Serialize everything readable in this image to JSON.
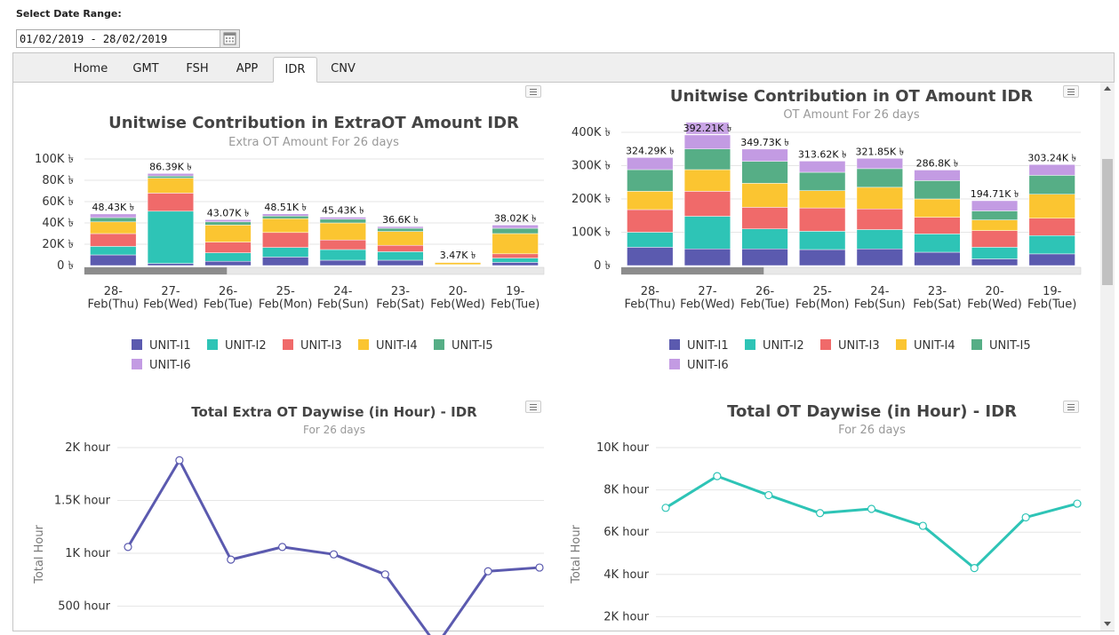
{
  "date_range": {
    "label": "Select Date Range:",
    "value": "01/02/2019 - 28/02/2019"
  },
  "tabs": [
    "Home",
    "GMT",
    "FSH",
    "APP",
    "IDR",
    "CNV"
  ],
  "active_tab": "IDR",
  "icons": {
    "calendar": "calendar-icon",
    "menu": "menu-icon"
  },
  "colors": {
    "unit_i1": "#5b5aaf",
    "unit_i2": "#2ec4b6",
    "unit_i3": "#f06a6a",
    "unit_i4": "#fbc531",
    "unit_i5": "#56ae86",
    "unit_i6": "#c39be3",
    "line_left": "#5b5aaf",
    "line_right": "#2ec4b6"
  },
  "chart_data": [
    {
      "type": "bar",
      "stacked": true,
      "title": "Unitwise Contribution in ExtraOT Amount IDR",
      "subtitle": "Extra OT Amount For 26 days",
      "categories": [
        "28-Feb(Thu)",
        "27-Feb(Wed)",
        "26-Feb(Tue)",
        "25-Feb(Mon)",
        "24-Feb(Sun)",
        "23-Feb(Sat)",
        "20-Feb(Wed)",
        "19-Feb(Tue)"
      ],
      "yticks": [
        "0 ৳",
        "20K ৳",
        "40K ৳",
        "60K ৳",
        "80K ৳",
        "100K ৳"
      ],
      "ylim": [
        0,
        100000
      ],
      "totals_labels": [
        "48.43K ৳",
        "86.39K ৳",
        "43.07K ৳",
        "48.51K ৳",
        "45.43K ৳",
        "36.6K ৳",
        "3.47K ৳",
        "38.02K ৳"
      ],
      "series": [
        {
          "name": "UNIT-I1",
          "values": [
            10000,
            2000,
            4000,
            8000,
            5000,
            5000,
            300,
            3000
          ]
        },
        {
          "name": "UNIT-I2",
          "values": [
            8000,
            49000,
            8000,
            9000,
            10000,
            8000,
            300,
            4000
          ]
        },
        {
          "name": "UNIT-I3",
          "values": [
            12000,
            17000,
            10000,
            14000,
            9000,
            6000,
            300,
            4000
          ]
        },
        {
          "name": "UNIT-I4",
          "values": [
            11000,
            14000,
            16000,
            13000,
            16000,
            13000,
            2000,
            19000
          ]
        },
        {
          "name": "UNIT-I5",
          "values": [
            4000,
            2000,
            3000,
            2500,
            3500,
            3000,
            300,
            5000
          ]
        },
        {
          "name": "UNIT-I6",
          "values": [
            3430,
            2390,
            2070,
            2010,
            1930,
            1600,
            270,
            3020
          ]
        }
      ]
    },
    {
      "type": "bar",
      "stacked": true,
      "title": "Unitwise Contribution in OT Amount IDR",
      "subtitle": "OT Amount For 26 days",
      "categories": [
        "28-Feb(Thu)",
        "27-Feb(Wed)",
        "26-Feb(Tue)",
        "25-Feb(Mon)",
        "24-Feb(Sun)",
        "23-Feb(Sat)",
        "20-Feb(Wed)",
        "19-Feb(Tue)"
      ],
      "yticks": [
        "0 ৳",
        "100K ৳",
        "200K ৳",
        "300K ৳",
        "400K ৳"
      ],
      "ylim": [
        0,
        400000
      ],
      "totals_labels": [
        "324.29K ৳",
        "392.21K ৳",
        "349.73K ৳",
        "313.62K ৳",
        "321.85K ৳",
        "286.8K ৳",
        "194.71K ৳",
        "303.24K ৳"
      ],
      "series": [
        {
          "name": "UNIT-I1",
          "values": [
            55000,
            50000,
            50000,
            48000,
            50000,
            40000,
            20000,
            35000
          ]
        },
        {
          "name": "UNIT-I2",
          "values": [
            45000,
            98000,
            60000,
            55000,
            58000,
            55000,
            35000,
            55000
          ]
        },
        {
          "name": "UNIT-I3",
          "values": [
            68000,
            75000,
            65000,
            70000,
            62000,
            50000,
            50000,
            52000
          ]
        },
        {
          "name": "UNIT-I4",
          "values": [
            55000,
            65000,
            72000,
            52000,
            65000,
            55000,
            32000,
            72000
          ]
        },
        {
          "name": "UNIT-I5",
          "values": [
            65000,
            62000,
            66000,
            55000,
            56000,
            55000,
            27000,
            57000
          ]
        },
        {
          "name": "UNIT-I6",
          "values": [
            36290,
            42210,
            36730,
            33620,
            30850,
            31800,
            30710,
            32240
          ]
        }
      ]
    },
    {
      "type": "line",
      "title": "Total Extra OT Daywise (in Hour) - IDR",
      "subtitle": "For 26 days",
      "ylabel": "Total Hour",
      "yticks": [
        "500 hour",
        "1K hour",
        "1.5K hour",
        "2K hour"
      ],
      "ylim": [
        0,
        2000
      ],
      "values": [
        1060,
        1880,
        940,
        1060,
        990,
        800,
        130,
        830,
        865
      ]
    },
    {
      "type": "line",
      "title": "Total OT Daywise (in Hour) - IDR",
      "subtitle": "For 26 days",
      "ylabel": "Total Hour",
      "yticks": [
        "2K hour",
        "4K hour",
        "6K hour",
        "8K hour",
        "10K hour"
      ],
      "ylim": [
        0,
        10000
      ],
      "values": [
        7150,
        8650,
        7750,
        6900,
        7100,
        6300,
        4300,
        6700,
        7350
      ]
    }
  ]
}
